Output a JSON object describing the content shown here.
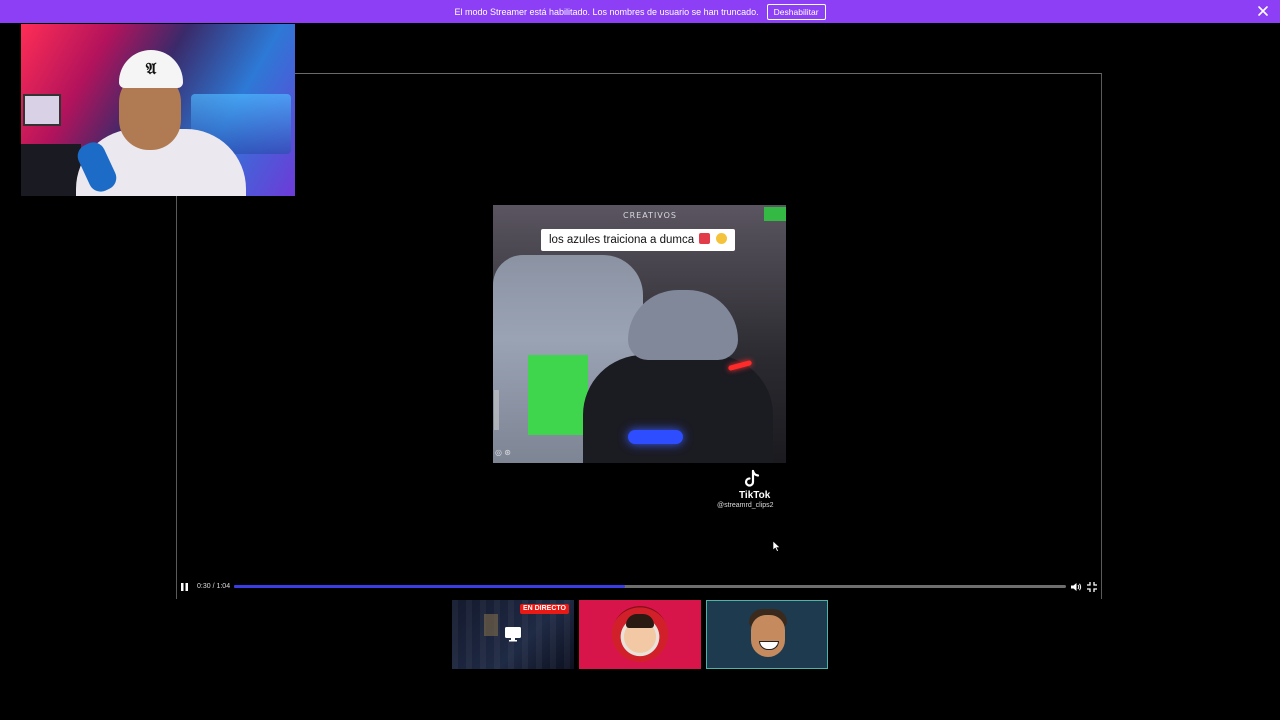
{
  "banner": {
    "text": "El modo Streamer está habilitado. Los nombres de usuario se han truncado.",
    "button_label": "Deshabilitar",
    "bg_color": "#8c3ff5"
  },
  "video": {
    "caption": "los azules traiciona a dumca",
    "overlay_logo": "CREATIVOS",
    "watermark_brand": "TikTok",
    "watermark_handle": "@streamrd_clips2"
  },
  "controls": {
    "time": "0:30 / 1:04",
    "progress_fraction": 0.47,
    "progress_color": "#3a3ce6"
  },
  "thumbnails": {
    "live_badge": "EN DIRECTO",
    "accent_colors": [
      "#d8154a",
      "#1d3a4e"
    ]
  },
  "icons": {
    "banner_close": "close-icon",
    "pause": "pause-icon",
    "volume": "volume-icon",
    "fullscreen": "exit-fullscreen-icon",
    "screen_share": "screen-share-icon",
    "tiktok": "tiktok-icon"
  }
}
